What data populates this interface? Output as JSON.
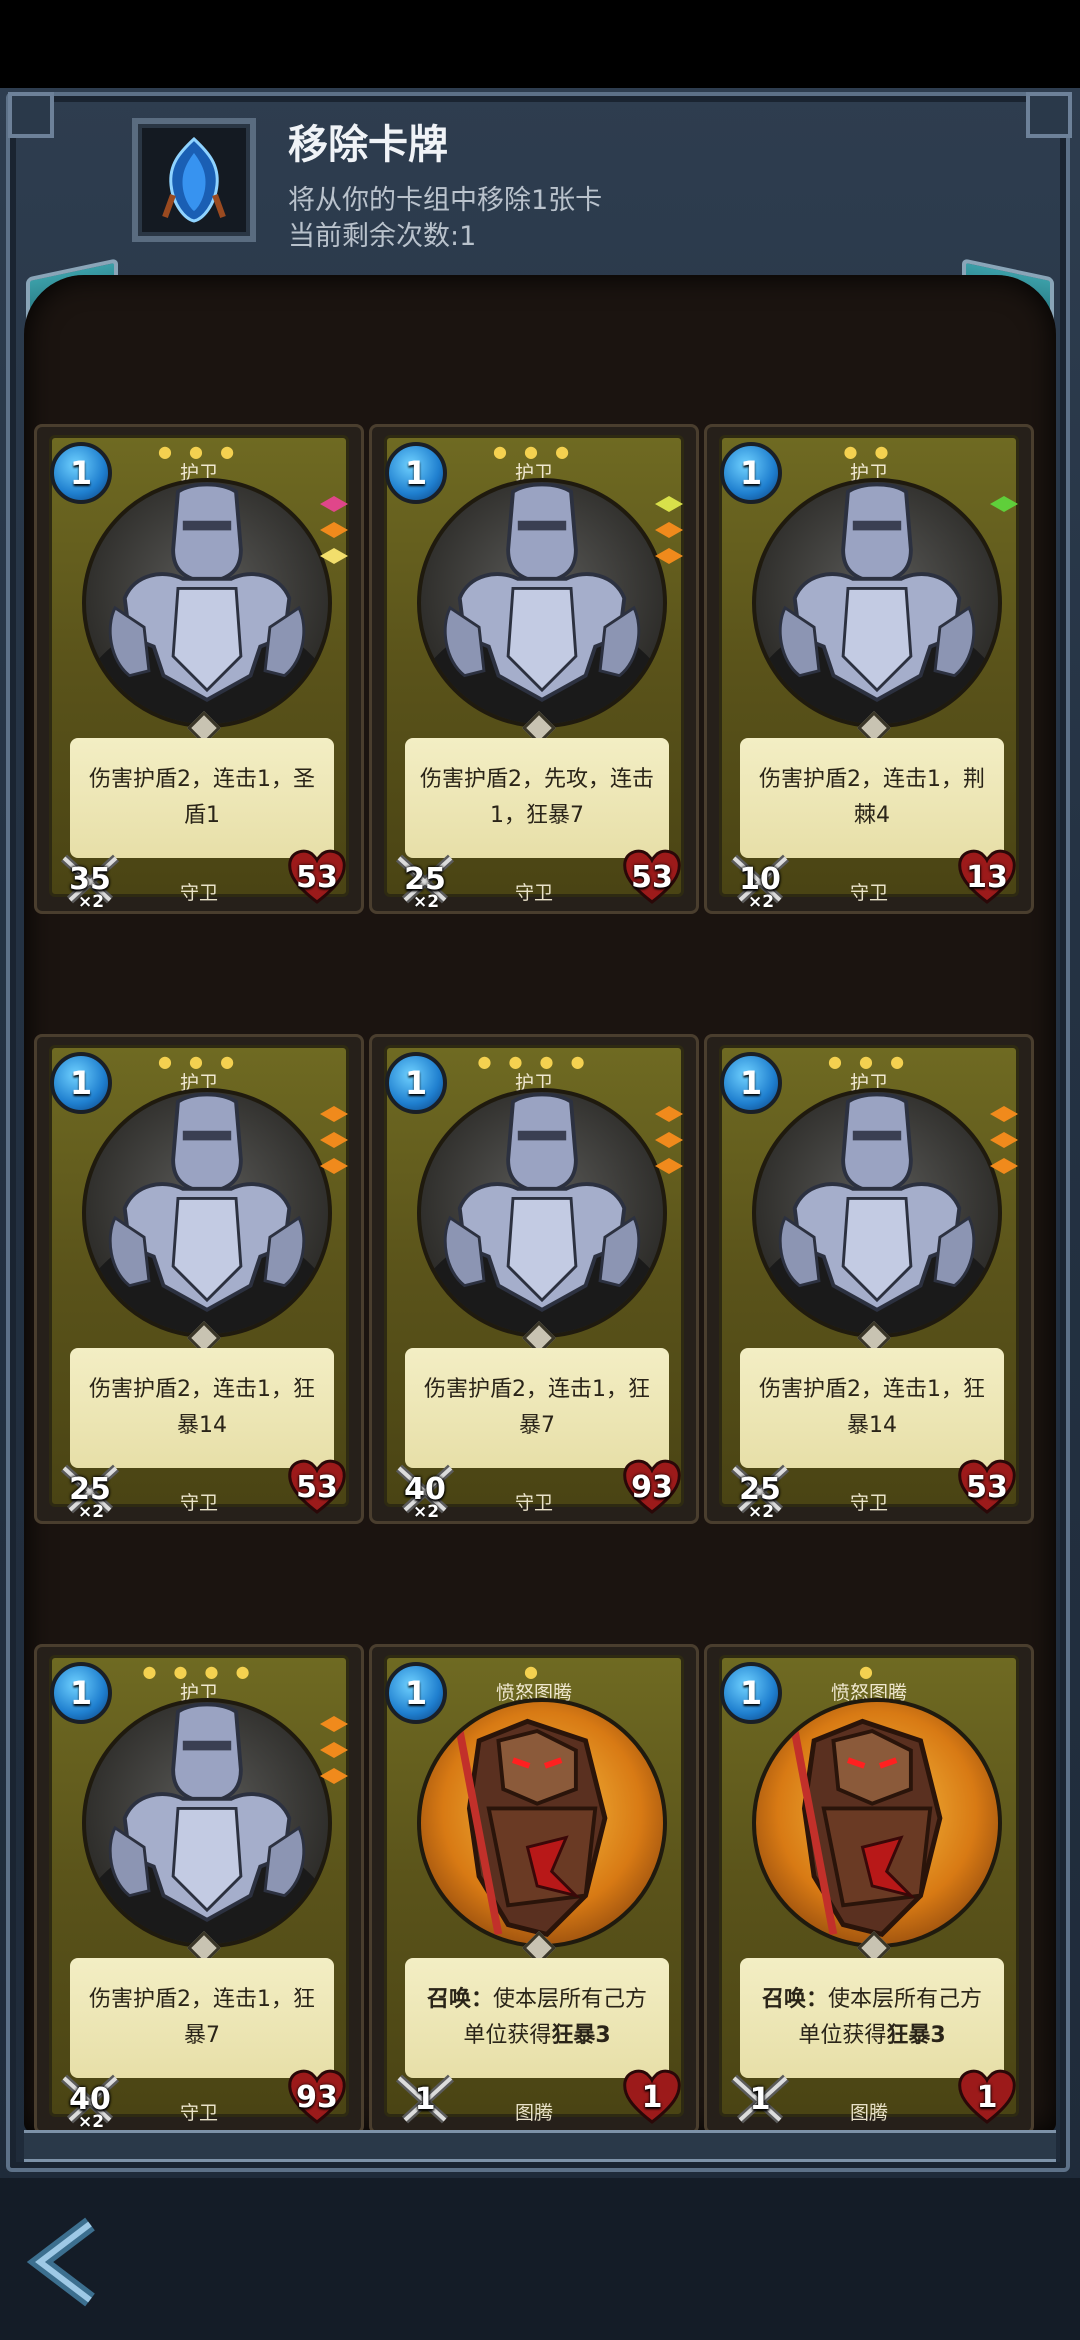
{
  "header": {
    "title": "移除卡牌",
    "subtitle": "将从你的卡组中移除1张卡",
    "remaining": "当前剩余次数:1"
  },
  "colors": {
    "gem_pink": "#e0468a",
    "gem_orange": "#f08a1c",
    "gem_yellow": "#f2de6c",
    "gem_lime": "#d8e04a",
    "gem_green": "#5fcf3a"
  },
  "cards": [
    {
      "cost": "1",
      "stars": "● ● ●",
      "type": "护卫",
      "portrait": "knight",
      "desc": "伤害护盾2，连击1，圣盾1",
      "attack": "35",
      "mult": "×2",
      "hp": "53",
      "class": "守卫",
      "gems": [
        "gem_pink",
        "gem_orange",
        "gem_yellow"
      ]
    },
    {
      "cost": "1",
      "stars": "● ● ●",
      "type": "护卫",
      "portrait": "knight",
      "desc": "伤害护盾2，先攻，连击1，狂暴7",
      "attack": "25",
      "mult": "×2",
      "hp": "53",
      "class": "守卫",
      "gems": [
        "gem_lime",
        "gem_orange",
        "gem_orange"
      ]
    },
    {
      "cost": "1",
      "stars": "● ●",
      "type": "护卫",
      "portrait": "knight",
      "desc": "伤害护盾2，连击1，荆棘4",
      "attack": "10",
      "mult": "×2",
      "hp": "13",
      "class": "守卫",
      "gems": [
        "gem_green"
      ]
    },
    {
      "cost": "1",
      "stars": "● ● ●",
      "type": "护卫",
      "portrait": "knight",
      "desc": "伤害护盾2，连击1，狂暴14",
      "attack": "25",
      "mult": "×2",
      "hp": "53",
      "class": "守卫",
      "gems": [
        "gem_orange",
        "gem_orange",
        "gem_orange"
      ]
    },
    {
      "cost": "1",
      "stars": "● ● ● ●",
      "type": "护卫",
      "portrait": "knight",
      "desc": "伤害护盾2，连击1，狂暴7",
      "attack": "40",
      "mult": "×2",
      "hp": "93",
      "class": "守卫",
      "gems": [
        "gem_orange",
        "gem_orange",
        "gem_orange"
      ]
    },
    {
      "cost": "1",
      "stars": "● ● ●",
      "type": "护卫",
      "portrait": "knight",
      "desc": "伤害护盾2，连击1，狂暴14",
      "attack": "25",
      "mult": "×2",
      "hp": "53",
      "class": "守卫",
      "gems": [
        "gem_orange",
        "gem_orange",
        "gem_orange"
      ]
    },
    {
      "cost": "1",
      "stars": "● ● ● ●",
      "type": "护卫",
      "portrait": "knight",
      "desc": "伤害护盾2，连击1，狂暴7",
      "attack": "40",
      "mult": "×2",
      "hp": "93",
      "class": "守卫",
      "gems": [
        "gem_orange",
        "gem_orange",
        "gem_orange"
      ]
    },
    {
      "cost": "1",
      "stars": "●",
      "type": "愤怒图腾",
      "portrait": "totem",
      "desc_bold": "召唤：",
      "desc": "使本层所有己方单位获得",
      "desc_bold2": "狂暴3",
      "attack": "1",
      "mult": "",
      "hp": "1",
      "class": "图腾",
      "gems": []
    },
    {
      "cost": "1",
      "stars": "●",
      "type": "愤怒图腾",
      "portrait": "totem",
      "desc_bold": "召唤：",
      "desc": "使本层所有己方单位获得",
      "desc_bold2": "狂暴3",
      "attack": "1",
      "mult": "",
      "hp": "1",
      "class": "图腾",
      "gems": []
    }
  ]
}
